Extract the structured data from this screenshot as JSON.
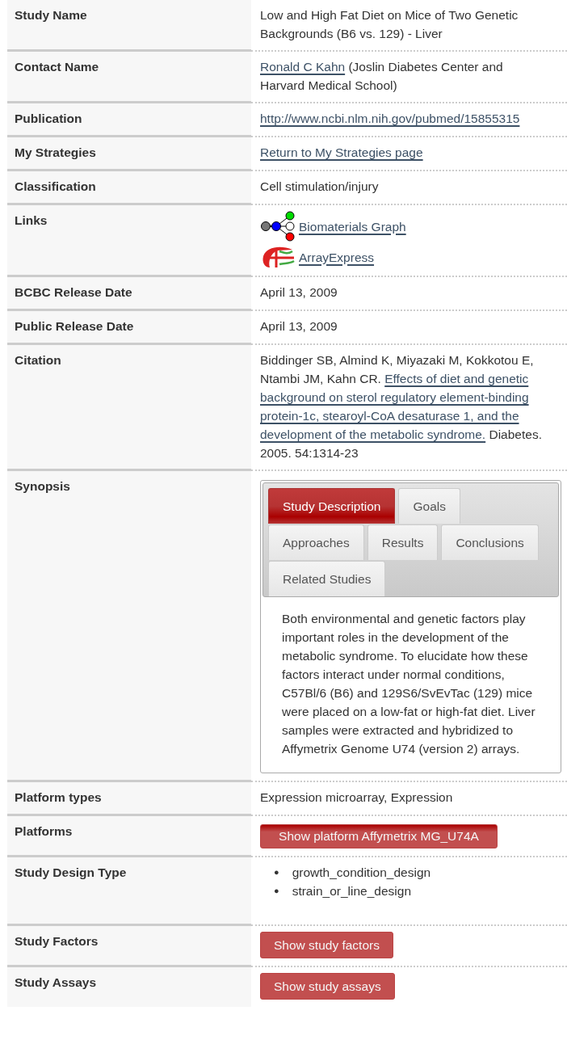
{
  "rows": [
    {
      "label": "Study Name",
      "value": {
        "kind": "text",
        "text": "Low and High Fat Diet on Mice of Two Genetic Backgrounds (B6 vs. 129) - Liver"
      }
    },
    {
      "label": "Contact Name",
      "value": {
        "kind": "lines",
        "lines": [
          [
            {
              "link": "Ronald C Kahn"
            },
            {
              "text": " (Joslin Diabetes Center and"
            }
          ],
          [
            {
              "text": "Harvard Medical School)"
            }
          ]
        ]
      }
    },
    {
      "label": "Publication",
      "value": {
        "kind": "lines",
        "lines": [
          [
            {
              "link": "http://www.ncbi.nlm.nih.gov/pubmed/15855315"
            }
          ]
        ]
      }
    },
    {
      "label": "My Strategies",
      "value": {
        "kind": "lines",
        "lines": [
          [
            {
              "link": "Return to My Strategies page"
            }
          ]
        ]
      }
    },
    {
      "label": "Classification",
      "value": {
        "kind": "text",
        "text": "Cell stimulation/injury"
      }
    },
    {
      "label": "Links",
      "value": {
        "kind": "links",
        "items": [
          {
            "text": "Biomaterials Graph"
          },
          {
            "text": "ArrayExpress"
          }
        ]
      }
    },
    {
      "label": "BCBC Release Date",
      "value": {
        "kind": "text",
        "text": "April 13, 2009"
      }
    },
    {
      "label": "Public Release Date",
      "value": {
        "kind": "text",
        "text": "April 13, 2009"
      }
    },
    {
      "label": "Citation",
      "value": {
        "kind": "lines",
        "lines": [
          [
            {
              "text": "Biddinger SB, Almind K, Miyazaki M, Kokkotou E,"
            }
          ],
          [
            {
              "text": "Ntambi JM, Kahn CR. "
            },
            {
              "link": "Effects of diet and genetic"
            }
          ],
          [
            {
              "link": "background on sterol regulatory element-binding"
            }
          ],
          [
            {
              "link": "protein-1c, stearoyl-CoA desaturase 1, and the"
            }
          ],
          [
            {
              "link": "development of the metabolic syndrome."
            },
            {
              "text": " Diabetes."
            }
          ],
          [
            {
              "text": "2005. 54:1314-23"
            }
          ]
        ]
      }
    },
    {
      "label": "Synopsis",
      "value": {
        "kind": "tabs",
        "tabs": [
          {
            "label": "Study Description",
            "selected": true
          },
          {
            "label": "Goals",
            "selected": false
          },
          {
            "label": "Approaches",
            "selected": false
          },
          {
            "label": "Results",
            "selected": false
          },
          {
            "label": "Conclusions",
            "selected": false
          },
          {
            "label": "Related Studies",
            "selected": false
          }
        ],
        "body": "Both environmental and genetic factors play important roles in the development of the metabolic syndrome. To elucidate how these factors interact under normal conditions, C57Bl/6 (B6) and 129S6/SvEvTac (129) mice were placed on a low-fat or high-fat diet. Liver samples were extracted and hybridized to Affymetrix Genome U74 (version 2) arrays."
      }
    },
    {
      "label": "Platform types",
      "value": {
        "kind": "text",
        "text": "Expression microarray, Expression"
      }
    },
    {
      "label": "Platforms",
      "value": {
        "kind": "wide_button",
        "text": "Show platform Affymetrix MG_U74A"
      }
    },
    {
      "label": "Study Design Type",
      "value": {
        "kind": "list",
        "items": [
          {
            "marker": "●",
            "text": "growth_condition_design"
          },
          {
            "marker": "●",
            "text": "strain_or_line_design"
          }
        ]
      }
    },
    {
      "label": "Study Factors",
      "value": {
        "kind": "button",
        "text": "Show study factors"
      }
    },
    {
      "label": "Study Assays",
      "value": {
        "kind": "button",
        "text": "Show study assays"
      }
    }
  ]
}
